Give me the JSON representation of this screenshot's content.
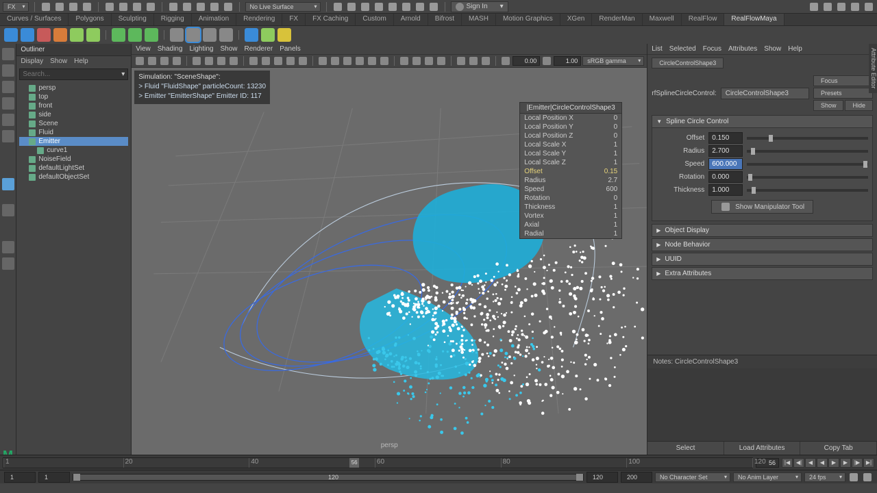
{
  "top": {
    "workspace": "FX",
    "liveSurface": "No Live Surface",
    "signIn": "Sign In"
  },
  "tabs": [
    "Curves / Surfaces",
    "Polygons",
    "Sculpting",
    "Rigging",
    "Animation",
    "Rendering",
    "FX",
    "FX Caching",
    "Custom",
    "Arnold",
    "Bifrost",
    "MASH",
    "Motion Graphics",
    "XGen",
    "RenderMan",
    "Maxwell",
    "RealFlow",
    "RealFlowMaya"
  ],
  "activeTab": 17,
  "outliner": {
    "title": "Outliner",
    "menus": [
      "Display",
      "Show",
      "Help"
    ],
    "searchPlaceholder": "Search...",
    "items": [
      {
        "label": "persp",
        "icon": "cam",
        "ind": 1
      },
      {
        "label": "top",
        "icon": "cam",
        "ind": 1
      },
      {
        "label": "front",
        "icon": "cam",
        "ind": 1
      },
      {
        "label": "side",
        "icon": "cam",
        "ind": 1
      },
      {
        "label": "Scene",
        "icon": "grp",
        "ind": 1
      },
      {
        "label": "Fluid",
        "icon": "grp",
        "ind": 1
      },
      {
        "label": "Emitter",
        "icon": "emi",
        "ind": 1,
        "sel": true
      },
      {
        "label": "curve1",
        "icon": "crv",
        "ind": 2
      },
      {
        "label": "NoiseField",
        "icon": "fld",
        "ind": 1
      },
      {
        "label": "defaultLightSet",
        "icon": "set",
        "ind": 1
      },
      {
        "label": "defaultObjectSet",
        "icon": "set",
        "ind": 1
      }
    ]
  },
  "viewport": {
    "menus": [
      "View",
      "Shading",
      "Lighting",
      "Show",
      "Renderer",
      "Panels"
    ],
    "num1": "0.00",
    "num2": "1.00",
    "gamma": "sRGB gamma",
    "hud": {
      "sim": "Simulation: \"SceneShape\":",
      "l1": "> Fluid \"FluidShape\" particleCount: 13230",
      "l2": "> Emitter \"EmitterShape\" Emitter ID: 117"
    },
    "popup": {
      "title": "|Emitter|CircleControlShape3",
      "rows": [
        {
          "k": "Local Position X",
          "v": "0"
        },
        {
          "k": "Local Position Y",
          "v": "0"
        },
        {
          "k": "Local Position Z",
          "v": "0"
        },
        {
          "k": "Local Scale X",
          "v": "1"
        },
        {
          "k": "Local Scale Y",
          "v": "1"
        },
        {
          "k": "Local Scale Z",
          "v": "1"
        },
        {
          "k": "Offset",
          "v": "0.15",
          "hl": true
        },
        {
          "k": "Radius",
          "v": "2.7"
        },
        {
          "k": "Speed",
          "v": "600"
        },
        {
          "k": "Rotation",
          "v": "0"
        },
        {
          "k": "Thickness",
          "v": "1"
        },
        {
          "k": "Vortex",
          "v": "1"
        },
        {
          "k": "Axial",
          "v": "1"
        },
        {
          "k": "Radial",
          "v": "1"
        }
      ]
    },
    "persp": "persp"
  },
  "attr": {
    "menus": [
      "List",
      "Selected",
      "Focus",
      "Attributes",
      "Show",
      "Help"
    ],
    "nodeTab": "CircleControlShape3",
    "typeLabel": "rfSplineCircleControl:",
    "typeVal": "CircleControlShape3",
    "focus": "Focus",
    "presets": "Presets",
    "showB": "Show",
    "hideB": "Hide",
    "sections": {
      "main": {
        "title": "Spline Circle Control",
        "fields": [
          {
            "label": "Offset",
            "val": "0.150",
            "pos": 18
          },
          {
            "label": "Radius",
            "val": "2.700",
            "pos": 3
          },
          {
            "label": "Speed",
            "val": "600.000",
            "pos": 96,
            "hl": true
          },
          {
            "label": "Rotation",
            "val": "0.000",
            "pos": 1
          },
          {
            "label": "Thickness",
            "val": "1.000",
            "pos": 4
          }
        ],
        "manip": "Show Manipulator Tool"
      },
      "closed": [
        "Object Display",
        "Node Behavior",
        "UUID",
        "Extra Attributes"
      ]
    },
    "notesLabel": "Notes:  CircleControlShape3",
    "bottom": [
      "Select",
      "Load Attributes",
      "Copy Tab"
    ],
    "sideTab": "Attribute Editor"
  },
  "timeline": {
    "ticks": [
      1,
      20,
      40,
      60,
      80,
      100,
      120
    ],
    "current": 56,
    "currentBox": "56"
  },
  "range": {
    "start": "1",
    "startVis": "1",
    "mid": "120",
    "end": "120",
    "endAlt": "200",
    "charset": "No Character Set",
    "animlayer": "No Anim Layer",
    "fps": "24 fps"
  }
}
